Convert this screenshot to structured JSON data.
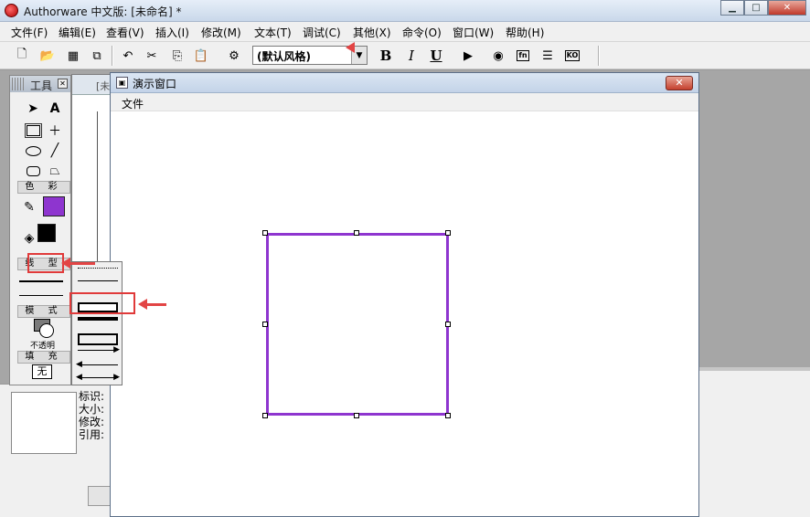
{
  "app": {
    "title": "Authorware 中文版: [未命名] *"
  },
  "window_controls": {
    "minimize": "▁",
    "maximize": "□",
    "close": "✕"
  },
  "menu": [
    "文件(F)",
    "编辑(E)",
    "查看(V)",
    "插入(I)",
    "修改(M)",
    "文本(T)",
    "调试(C)",
    "其他(X)",
    "命令(O)",
    "窗口(W)",
    "帮助(H)"
  ],
  "toolbar": {
    "style_value": "(默认风格)",
    "bold": "B",
    "italic": "I",
    "underline": "U",
    "fn_label": "fn",
    "ko_label": "KO"
  },
  "flow_window": {
    "tab_label": "[未"
  },
  "tools_palette": {
    "title": "工具",
    "color_label": "色 彩",
    "linetype_label": "线 型",
    "mode_label": "模 式",
    "opacity_label": "不透明",
    "fill_label": "填 充",
    "fill_value": "无"
  },
  "colors": {
    "fill_swatch": "#8e35cf",
    "fore_swatch": "#000000",
    "highlight": "#e03a3a",
    "square_border": "#8e35cf"
  },
  "info_panel": {
    "lines": [
      "标识:",
      "大小:",
      "修改:",
      "引用:"
    ]
  },
  "presentation_window": {
    "title": "演示窗口",
    "menu_file": "文件",
    "close": "✕"
  }
}
